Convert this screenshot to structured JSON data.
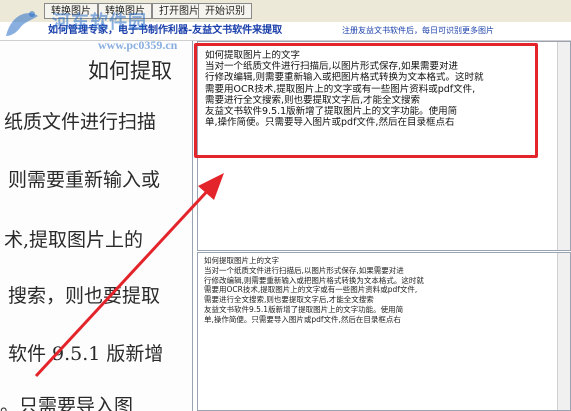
{
  "toolbar": {
    "buttons": [
      {
        "label": "转换图片"
      },
      {
        "label": "转换图片"
      },
      {
        "label": "打开图片"
      },
      {
        "label": "开始识别"
      }
    ],
    "promo_text": "如何管理专家，电子书制作利器-友益文书软件来提取",
    "note_text": "注册友益文书软件后，每日可识别更多图片"
  },
  "watermark": {
    "title": "河东软件园",
    "url": "www.pc0359.cn"
  },
  "document": {
    "title": "如何提取",
    "lines": [
      "纸质文件进行扫描",
      "则需要重新输入或",
      "术,提取图片上的",
      "搜索，则也要提取",
      "软件 9.5.1 版新增",
      "。只需要导入图"
    ]
  },
  "result": {
    "lines": [
      "如何提取图片上的文字",
      "当对一个纸质文件进行扫描后,以图片形式保存,如果需要对进",
      "行修改编辑,则需要重新输入或把图片格式转换为文本格式。这时就",
      "需要用OCR技术,提取图片上的文字或有一些图片资料或pdf文件,",
      "需要进行全文搜索,则也要提取文字后,才能全文搜索",
      "友益文书软件9.5.1版新增了提取图片上的文字功能。使用简",
      "单,操作简便。只需要导入图片或pdf文件,然后在目录框点右"
    ]
  },
  "preview": {
    "lines": [
      "如何提取图片上的文字",
      "当对一个纸质文件进行扫描后,以图片形式保存,如果需要对进",
      "行修改编辑,则需要重新输入或把图片格式转换为文本格式。这时就",
      "需要用OCR技术,提取图片上的文字或有一些图片资料或pdf文件,",
      "需要进行全文搜索,则也要提取文字后,才能全文搜索",
      "友益文书软件9.5.1版新增了提取图片上的文字功能。使用简",
      "单,操作简便。只需要导入图片或pdf文件,然后在目录框点右"
    ]
  },
  "colors": {
    "annotation": "#e3242b",
    "link_blue": "#1a3faa"
  }
}
